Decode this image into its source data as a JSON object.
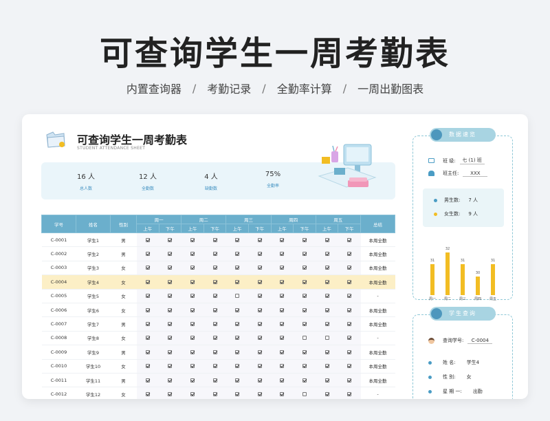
{
  "page": {
    "title": "可查询学生一周考勤表",
    "subnav": [
      "内置查询器",
      "考勤记录",
      "全勤率计算",
      "一周出勤图表"
    ]
  },
  "sheet": {
    "title": "可查询学生一周考勤表",
    "subtitle": "STUDENT ATTENDANCE SHEET"
  },
  "stats": [
    {
      "value": "16 人",
      "label": "总人数"
    },
    {
      "value": "12 人",
      "label": "全勤数"
    },
    {
      "value": "4 人",
      "label": "缺勤数"
    },
    {
      "value": "75%",
      "label": "全勤率"
    }
  ],
  "table": {
    "headers": {
      "id": "学号",
      "name": "姓名",
      "gender": "性别",
      "total": "总结",
      "am": "上午",
      "pm": "下午"
    },
    "days": [
      "周一",
      "周二",
      "周三",
      "周四",
      "周五"
    ],
    "rows": [
      {
        "id": "C-0001",
        "name": "学生1",
        "gender": "男",
        "marks": [
          1,
          1,
          1,
          1,
          1,
          1,
          1,
          1,
          1,
          1
        ],
        "summary": "本周全勤"
      },
      {
        "id": "C-0002",
        "name": "学生2",
        "gender": "男",
        "marks": [
          1,
          1,
          1,
          1,
          1,
          1,
          1,
          1,
          1,
          1
        ],
        "summary": "本周全勤"
      },
      {
        "id": "C-0003",
        "name": "学生3",
        "gender": "女",
        "marks": [
          1,
          1,
          1,
          1,
          1,
          1,
          1,
          1,
          1,
          1
        ],
        "summary": "本周全勤"
      },
      {
        "id": "C-0004",
        "name": "学生4",
        "gender": "女",
        "marks": [
          1,
          1,
          1,
          1,
          1,
          1,
          1,
          1,
          1,
          1
        ],
        "summary": "本周全勤",
        "highlight": true
      },
      {
        "id": "C-0005",
        "name": "学生5",
        "gender": "女",
        "marks": [
          1,
          1,
          1,
          1,
          0,
          1,
          1,
          1,
          1,
          1
        ],
        "summary": "-"
      },
      {
        "id": "C-0006",
        "name": "学生6",
        "gender": "女",
        "marks": [
          1,
          1,
          1,
          1,
          1,
          1,
          1,
          1,
          1,
          1
        ],
        "summary": "本周全勤"
      },
      {
        "id": "C-0007",
        "name": "学生7",
        "gender": "男",
        "marks": [
          1,
          1,
          1,
          1,
          1,
          1,
          1,
          1,
          1,
          1
        ],
        "summary": "本周全勤"
      },
      {
        "id": "C-0008",
        "name": "学生8",
        "gender": "女",
        "marks": [
          1,
          1,
          1,
          1,
          1,
          1,
          1,
          0,
          0,
          1
        ],
        "summary": "-"
      },
      {
        "id": "C-0009",
        "name": "学生9",
        "gender": "男",
        "marks": [
          1,
          1,
          1,
          1,
          1,
          1,
          1,
          1,
          1,
          1
        ],
        "summary": "本周全勤"
      },
      {
        "id": "C-0010",
        "name": "学生10",
        "gender": "女",
        "marks": [
          1,
          1,
          1,
          1,
          1,
          1,
          1,
          1,
          1,
          1
        ],
        "summary": "本周全勤"
      },
      {
        "id": "C-0011",
        "name": "学生11",
        "gender": "男",
        "marks": [
          1,
          1,
          1,
          1,
          1,
          1,
          1,
          1,
          1,
          1
        ],
        "summary": "本周全勤"
      },
      {
        "id": "C-0012",
        "name": "学生12",
        "gender": "女",
        "marks": [
          1,
          1,
          1,
          1,
          1,
          1,
          1,
          0,
          1,
          1
        ],
        "summary": "-"
      }
    ]
  },
  "overview": {
    "title": "数据速览",
    "class_label": "班  级:",
    "class_value": "七 (1) 班",
    "teacher_label": "班主任:",
    "teacher_value": "XXX",
    "male_label": "男生数:",
    "male_value": "7 人",
    "female_label": "女生数:",
    "female_value": "9 人",
    "male_color": "#4a9cc4",
    "female_color": "#f2bd23"
  },
  "chart_data": {
    "type": "bar",
    "categories": [
      "周一",
      "周二",
      "周三",
      "周四",
      "周五"
    ],
    "values": [
      31,
      32,
      31,
      30,
      31
    ],
    "ylim": [
      29,
      32
    ],
    "color": "#f2bd23"
  },
  "query": {
    "title": "学生查询",
    "id_label": "查询学号:",
    "id_value": "C-0004",
    "name_label": "姓    名:",
    "name_value": "学生4",
    "gender_label": "性    别:",
    "gender_value": "女",
    "day_label": "星 期 一:",
    "day_value": "出勤"
  }
}
